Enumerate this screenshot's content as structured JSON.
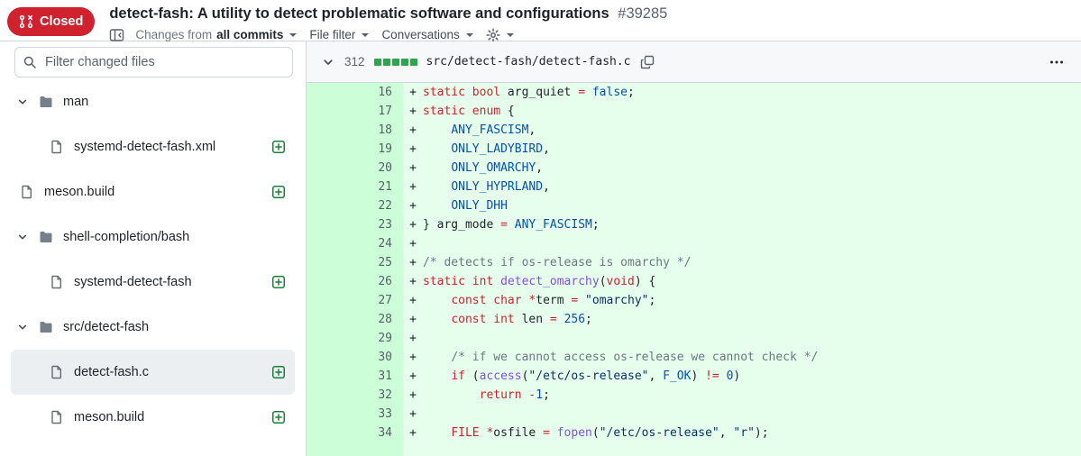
{
  "page": {
    "status": "Closed",
    "title": "detect-fash: A utility to detect problematic software and configurations",
    "number": "#39285"
  },
  "toolbar": {
    "changes_from": "Changes from",
    "changes_from_value": "all commits",
    "file_filter": "File filter",
    "conversations": "Conversations"
  },
  "sidebar": {
    "filter_placeholder": "Filter changed files",
    "tree": [
      {
        "kind": "folder",
        "label": "man",
        "depth": 0,
        "expanded": true
      },
      {
        "kind": "file",
        "label": "systemd-detect-fash.xml",
        "depth": 1,
        "status": "added"
      },
      {
        "kind": "file",
        "label": "meson.build",
        "depth": 0,
        "status": "added"
      },
      {
        "kind": "folder",
        "label": "shell-completion/bash",
        "depth": 0,
        "expanded": true
      },
      {
        "kind": "file",
        "label": "systemd-detect-fash",
        "depth": 1,
        "status": "added"
      },
      {
        "kind": "folder",
        "label": "src/detect-fash",
        "depth": 0,
        "expanded": true
      },
      {
        "kind": "file",
        "label": "detect-fash.c",
        "depth": 1,
        "status": "added",
        "selected": true
      },
      {
        "kind": "file",
        "label": "meson.build",
        "depth": 1,
        "status": "added"
      }
    ]
  },
  "file": {
    "changed_lines": "312",
    "diffstat_blocks": 5,
    "path": "src/detect-fash/detect-fash.c"
  },
  "icons": {
    "status_badge": "git-pull-request-closed",
    "toolbar": [
      "sidebar-toggle",
      "caret-down",
      "gear"
    ],
    "sidebar": [
      "search",
      "chevron-down",
      "folder-fill",
      "file",
      "diff-added"
    ],
    "file_header": [
      "chevron-down",
      "copy",
      "kebab-horizontal"
    ]
  },
  "colors": {
    "closed_badge": "#cf222e",
    "addition_bg": "#e6ffec",
    "addition_gutter_bg": "#ccffd8",
    "diffstat_green": "#2da44e",
    "added_icon_green": "#1a7f37",
    "syntax": {
      "keyword": "#cf222e",
      "constant": "#0550ae",
      "string": "#0a3069",
      "function": "#8250df",
      "comment": "#6e7781",
      "plain": "#1f2328"
    }
  },
  "diff_lines": [
    {
      "num": "16",
      "sign": "+",
      "tokens": [
        [
          "k",
          "static"
        ],
        [
          "p",
          " "
        ],
        [
          "k",
          "bool"
        ],
        [
          "p",
          " arg_quiet "
        ],
        [
          "o",
          "="
        ],
        [
          "p",
          " "
        ],
        [
          "c",
          "false"
        ],
        [
          "p",
          ";"
        ]
      ]
    },
    {
      "num": "17",
      "sign": "+",
      "tokens": [
        [
          "k",
          "static"
        ],
        [
          "p",
          " "
        ],
        [
          "k",
          "enum"
        ],
        [
          "p",
          " {"
        ]
      ]
    },
    {
      "num": "18",
      "sign": "+",
      "tokens": [
        [
          "p",
          "    "
        ],
        [
          "c",
          "ANY_FASCISM"
        ],
        [
          "p",
          ","
        ]
      ]
    },
    {
      "num": "19",
      "sign": "+",
      "tokens": [
        [
          "p",
          "    "
        ],
        [
          "c",
          "ONLY_LADYBIRD"
        ],
        [
          "p",
          ","
        ]
      ]
    },
    {
      "num": "20",
      "sign": "+",
      "tokens": [
        [
          "p",
          "    "
        ],
        [
          "c",
          "ONLY_OMARCHY"
        ],
        [
          "p",
          ","
        ]
      ]
    },
    {
      "num": "21",
      "sign": "+",
      "tokens": [
        [
          "p",
          "    "
        ],
        [
          "c",
          "ONLY_HYPRLAND"
        ],
        [
          "p",
          ","
        ]
      ]
    },
    {
      "num": "22",
      "sign": "+",
      "tokens": [
        [
          "p",
          "    "
        ],
        [
          "c",
          "ONLY_DHH"
        ]
      ]
    },
    {
      "num": "23",
      "sign": "+",
      "tokens": [
        [
          "p",
          "} arg_mode "
        ],
        [
          "o",
          "="
        ],
        [
          "p",
          " "
        ],
        [
          "c",
          "ANY_FASCISM"
        ],
        [
          "p",
          ";"
        ]
      ]
    },
    {
      "num": "24",
      "sign": "+",
      "tokens": []
    },
    {
      "num": "25",
      "sign": "+",
      "tokens": [
        [
          "m",
          "/* detects if os-release is omarchy */"
        ]
      ]
    },
    {
      "num": "26",
      "sign": "+",
      "tokens": [
        [
          "k",
          "static"
        ],
        [
          "p",
          " "
        ],
        [
          "k",
          "int"
        ],
        [
          "p",
          " "
        ],
        [
          "f",
          "detect_omarchy"
        ],
        [
          "p",
          "("
        ],
        [
          "k",
          "void"
        ],
        [
          "p",
          ") {"
        ]
      ]
    },
    {
      "num": "27",
      "sign": "+",
      "tokens": [
        [
          "p",
          "    "
        ],
        [
          "k",
          "const"
        ],
        [
          "p",
          " "
        ],
        [
          "k",
          "char"
        ],
        [
          "p",
          " "
        ],
        [
          "o",
          "*"
        ],
        [
          "p",
          "term "
        ],
        [
          "o",
          "="
        ],
        [
          "p",
          " "
        ],
        [
          "s",
          "\"omarchy\""
        ],
        [
          "p",
          ";"
        ]
      ]
    },
    {
      "num": "28",
      "sign": "+",
      "tokens": [
        [
          "p",
          "    "
        ],
        [
          "k",
          "const"
        ],
        [
          "p",
          " "
        ],
        [
          "k",
          "int"
        ],
        [
          "p",
          " len "
        ],
        [
          "o",
          "="
        ],
        [
          "p",
          " "
        ],
        [
          "c",
          "256"
        ],
        [
          "p",
          ";"
        ]
      ]
    },
    {
      "num": "29",
      "sign": "+",
      "tokens": []
    },
    {
      "num": "30",
      "sign": "+",
      "tokens": [
        [
          "p",
          "    "
        ],
        [
          "m",
          "/* if we cannot access os-release we cannot check */"
        ]
      ]
    },
    {
      "num": "31",
      "sign": "+",
      "tokens": [
        [
          "p",
          "    "
        ],
        [
          "k",
          "if"
        ],
        [
          "p",
          " ("
        ],
        [
          "f",
          "access"
        ],
        [
          "p",
          "("
        ],
        [
          "s",
          "\"/etc/os-release\""
        ],
        [
          "p",
          ", "
        ],
        [
          "c",
          "F_OK"
        ],
        [
          "p",
          ") "
        ],
        [
          "o",
          "!="
        ],
        [
          "p",
          " "
        ],
        [
          "c",
          "0"
        ],
        [
          "p",
          ")"
        ]
      ]
    },
    {
      "num": "32",
      "sign": "+",
      "tokens": [
        [
          "p",
          "        "
        ],
        [
          "k",
          "return"
        ],
        [
          "p",
          " "
        ],
        [
          "o",
          "-"
        ],
        [
          "c",
          "1"
        ],
        [
          "p",
          ";"
        ]
      ]
    },
    {
      "num": "33",
      "sign": "+",
      "tokens": []
    },
    {
      "num": "34",
      "sign": "+",
      "tokens": [
        [
          "p",
          "    "
        ],
        [
          "k",
          "FILE"
        ],
        [
          "p",
          " "
        ],
        [
          "o",
          "*"
        ],
        [
          "p",
          "osfile "
        ],
        [
          "o",
          "="
        ],
        [
          "p",
          " "
        ],
        [
          "f",
          "fopen"
        ],
        [
          "p",
          "("
        ],
        [
          "s",
          "\"/etc/os-release\""
        ],
        [
          "p",
          ", "
        ],
        [
          "s",
          "\"r\""
        ],
        [
          "p",
          ");"
        ]
      ]
    }
  ]
}
